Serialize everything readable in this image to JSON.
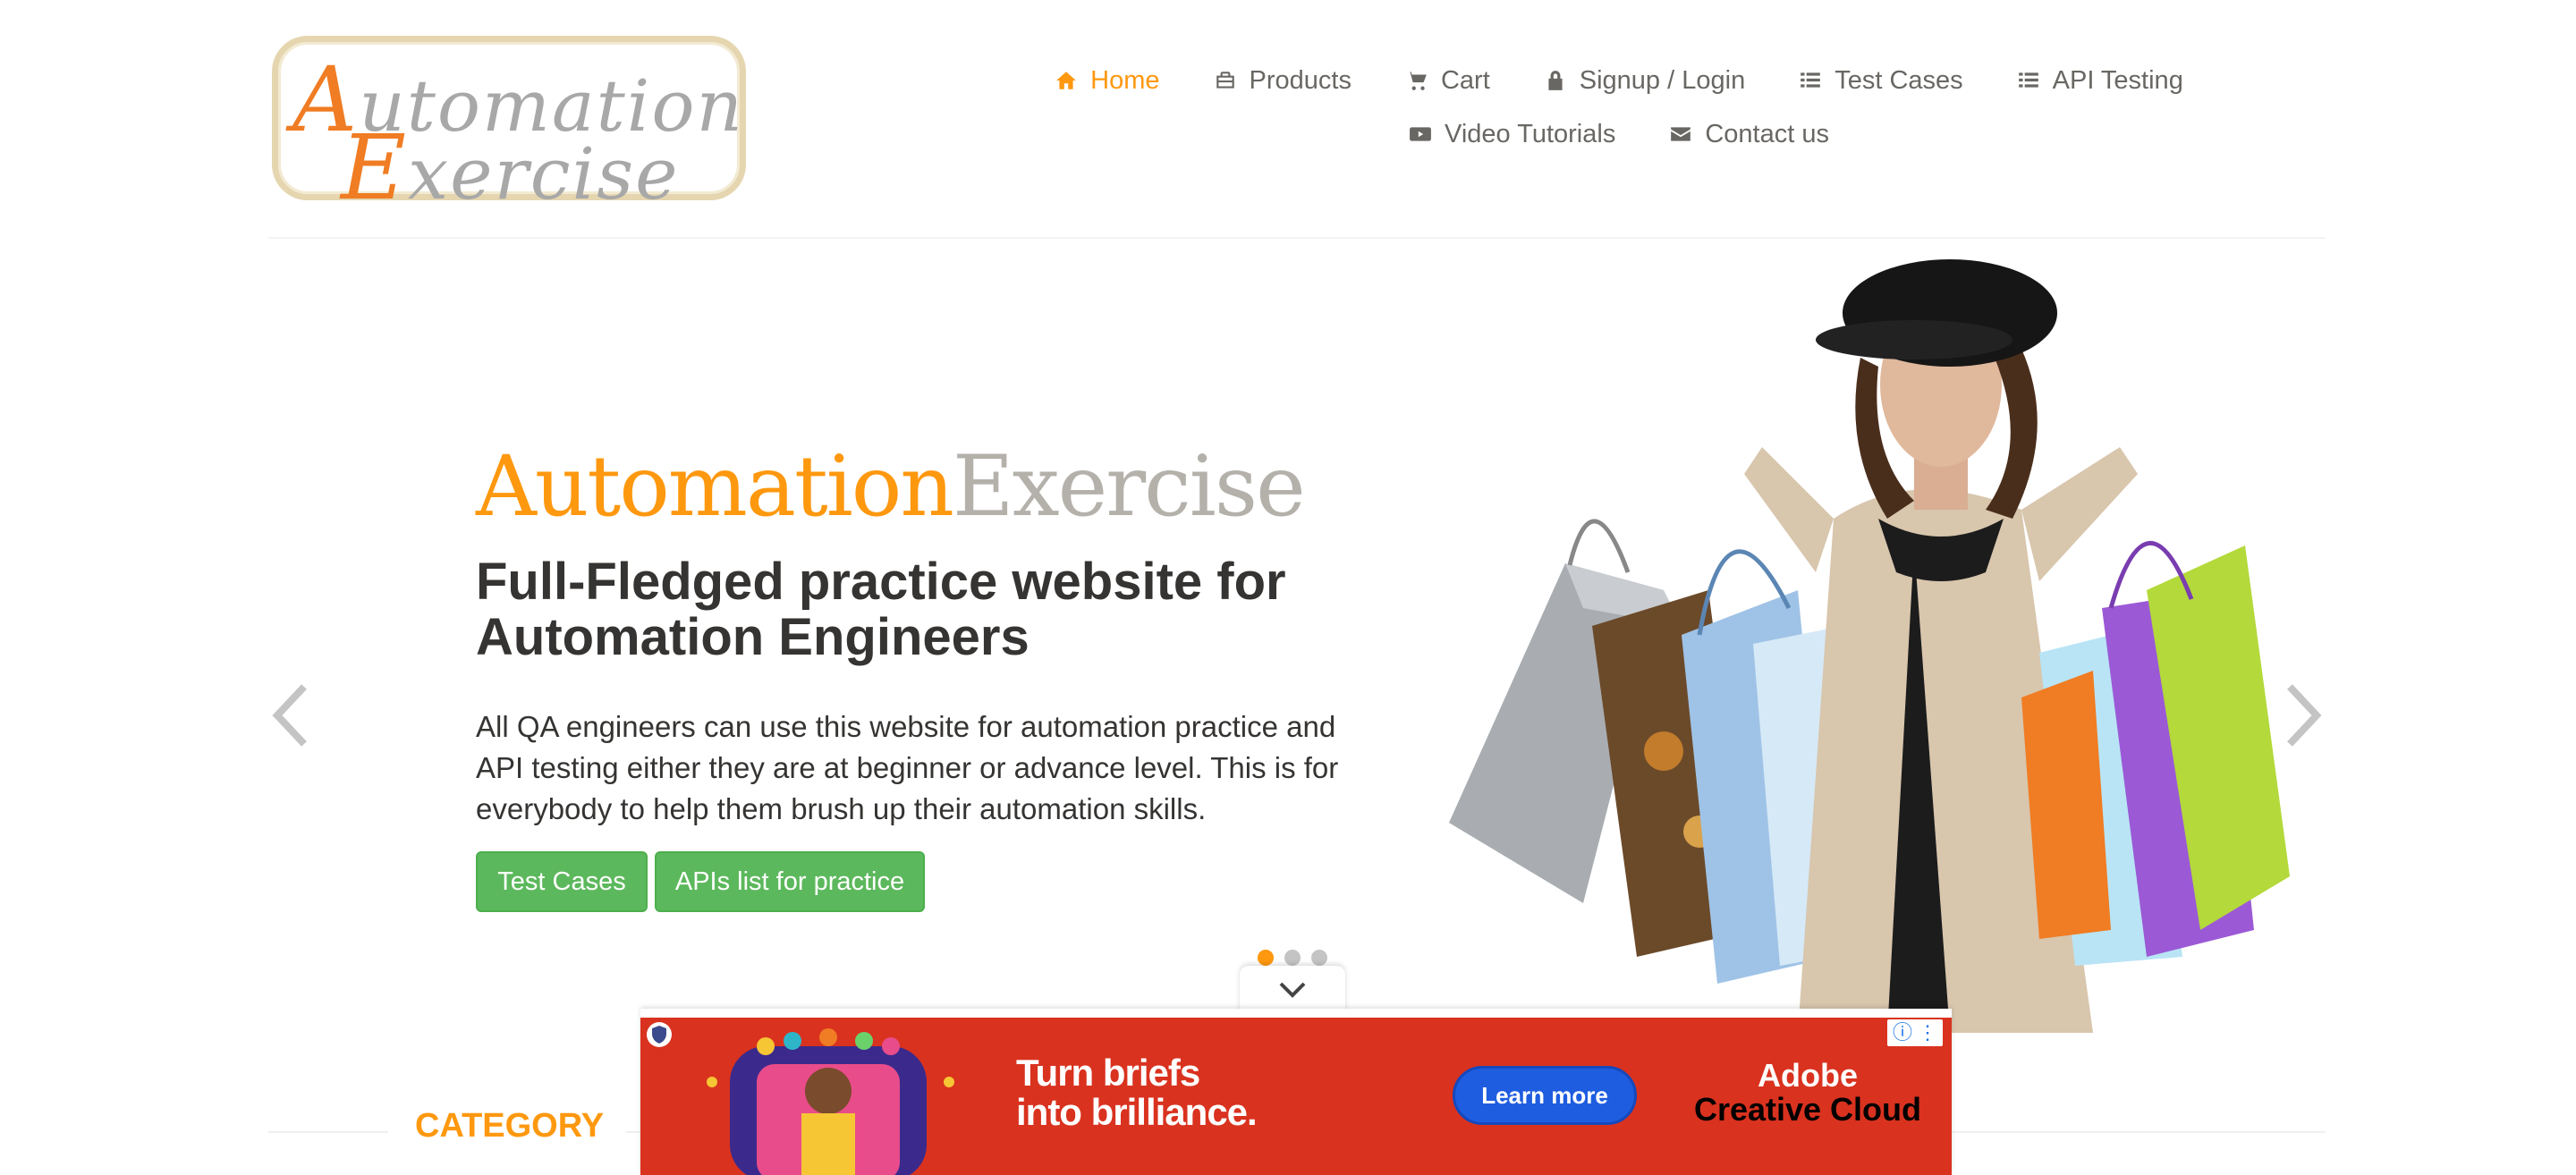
{
  "header": {
    "logo": {
      "line1": "Automation",
      "line2": "Exercise"
    },
    "nav": [
      {
        "label": "Home",
        "icon": "home-icon",
        "active": true
      },
      {
        "label": "Products",
        "icon": "briefcase-icon"
      },
      {
        "label": "Cart",
        "icon": "cart-icon"
      },
      {
        "label": "Signup / Login",
        "icon": "lock-icon"
      },
      {
        "label": "Test Cases",
        "icon": "list-icon"
      },
      {
        "label": "API Testing",
        "icon": "list-icon"
      },
      {
        "label": "Video Tutorials",
        "icon": "youtube-play-icon"
      },
      {
        "label": "Contact us",
        "icon": "envelope-icon"
      }
    ]
  },
  "slider": {
    "brand_part1": "Automation",
    "brand_part2": "Exercise",
    "headline": "Full-Fledged practice website for Automation Engineers",
    "description": "All QA engineers can use this website for automation practice and API testing either they are at beginner or advance level. This is for everybody to help them brush up their automation skills.",
    "buttons": [
      "Test Cases",
      "APIs list for practice"
    ],
    "slide_count": 3,
    "active_slide": 1
  },
  "category": {
    "title": "CATEGORY"
  },
  "ad": {
    "headline_line1": "Turn briefs",
    "headline_line2": "into brilliance.",
    "cta": "Learn more",
    "brand_line1": "Adobe",
    "brand_line2": "Creative Cloud",
    "info_icon": "info-icon",
    "menu_icon": "kebab-menu-icon"
  },
  "colors": {
    "accent": "#fe980f",
    "text": "#696763",
    "button_green": "#5cb85c",
    "ad_red": "#d9321f",
    "ad_button": "#1e5de0"
  }
}
